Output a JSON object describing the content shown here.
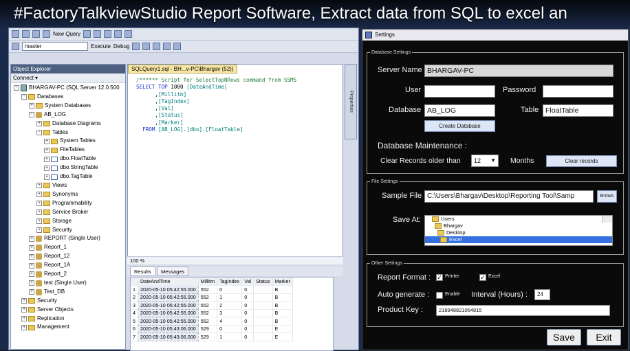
{
  "video_title": "#FactoryTalkviewStudio Report Software, Extract data from SQL to excel an",
  "ssms": {
    "new_query": "New Query",
    "db_combo": "master",
    "execute": "Execute",
    "debug": "Debug",
    "object_explorer": {
      "title": "Object Explorer",
      "connect": "Connect",
      "tree": [
        {
          "label": "BHARGAV-PC (SQL Server 12.0.500",
          "level": 0,
          "exp": "-",
          "icon": "server-icon"
        },
        {
          "label": "Databases",
          "level": 1,
          "exp": "-",
          "icon": "folder-icon"
        },
        {
          "label": "System Databases",
          "level": 2,
          "exp": "+",
          "icon": "folder-icon"
        },
        {
          "label": "AB_LOG",
          "level": 2,
          "exp": "-",
          "icon": "database-icon"
        },
        {
          "label": "Database Diagrams",
          "level": 3,
          "exp": "+",
          "icon": "folder-icon"
        },
        {
          "label": "Tables",
          "level": 3,
          "exp": "-",
          "icon": "folder-icon"
        },
        {
          "label": "System Tables",
          "level": 4,
          "exp": "+",
          "icon": "folder-icon"
        },
        {
          "label": "FileTables",
          "level": 4,
          "exp": "+",
          "icon": "folder-icon"
        },
        {
          "label": "dbo.FloatTable",
          "level": 4,
          "exp": "+",
          "icon": "table-icon"
        },
        {
          "label": "dbo.StringTable",
          "level": 4,
          "exp": "+",
          "icon": "table-icon"
        },
        {
          "label": "dbo.TagTable",
          "level": 4,
          "exp": "+",
          "icon": "table-icon"
        },
        {
          "label": "Views",
          "level": 3,
          "exp": "+",
          "icon": "folder-icon"
        },
        {
          "label": "Synonyms",
          "level": 3,
          "exp": "+",
          "icon": "folder-icon"
        },
        {
          "label": "Programmability",
          "level": 3,
          "exp": "+",
          "icon": "folder-icon"
        },
        {
          "label": "Service Broker",
          "level": 3,
          "exp": "+",
          "icon": "folder-icon"
        },
        {
          "label": "Storage",
          "level": 3,
          "exp": "+",
          "icon": "folder-icon"
        },
        {
          "label": "Security",
          "level": 3,
          "exp": "+",
          "icon": "folder-icon"
        },
        {
          "label": "REPORT (Single User)",
          "level": 2,
          "exp": "+",
          "icon": "database-icon"
        },
        {
          "label": "Report_1",
          "level": 2,
          "exp": "+",
          "icon": "database-icon"
        },
        {
          "label": "Report_12",
          "level": 2,
          "exp": "+",
          "icon": "database-icon"
        },
        {
          "label": "Report_1A",
          "level": 2,
          "exp": "+",
          "icon": "database-icon"
        },
        {
          "label": "Report_2",
          "level": 2,
          "exp": "+",
          "icon": "database-icon"
        },
        {
          "label": "test (Single User)",
          "level": 2,
          "exp": "+",
          "icon": "database-icon"
        },
        {
          "label": "Test_DB",
          "level": 2,
          "exp": "+",
          "icon": "database-icon"
        },
        {
          "label": "Security",
          "level": 1,
          "exp": "+",
          "icon": "folder-icon"
        },
        {
          "label": "Server Objects",
          "level": 1,
          "exp": "+",
          "icon": "folder-icon"
        },
        {
          "label": "Replication",
          "level": 1,
          "exp": "+",
          "icon": "folder-icon"
        },
        {
          "label": "Management",
          "level": 1,
          "exp": "+",
          "icon": "folder-icon"
        }
      ]
    },
    "editor": {
      "tab": "SQLQuery1.sql - BH...v-PC\\Bhargav (52))",
      "lines": [
        "/****** Script for SelectTopNRows command from SSMS",
        "SELECT TOP 1000 [DateAndTime]",
        "      ,[Millitm]",
        "      ,[TagIndex]",
        "      ,[Val]",
        "      ,[Status]",
        "      ,[Marker]",
        "  FROM [AB_LOG].[dbo].[FloatTable]"
      ]
    },
    "zoom": "100 %",
    "result_tabs": {
      "results": "Results",
      "messages": "Messages"
    },
    "results": {
      "columns": [
        "",
        "DateAndTime",
        "Millitm",
        "TagIndex",
        "Val",
        "Status",
        "Marker"
      ],
      "rows": [
        [
          "1",
          "2020-05-10 05:42:55.000",
          "552",
          "0",
          "0",
          "",
          "B"
        ],
        [
          "2",
          "2020-05-10 05:42:55.000",
          "552",
          "1",
          "0",
          "",
          "B"
        ],
        [
          "3",
          "2020-05-10 05:42:55.000",
          "552",
          "2",
          "0",
          "",
          "B"
        ],
        [
          "4",
          "2020-05-10 05:42:55.000",
          "552",
          "3",
          "0",
          "",
          "B"
        ],
        [
          "5",
          "2020-05-10 05:42:55.000",
          "552",
          "4",
          "0",
          "",
          "B"
        ],
        [
          "6",
          "2020-05-10 05:43:06.000",
          "529",
          "0",
          "0",
          "",
          "E"
        ],
        [
          "7",
          "2020-05-10 05:43:06.000",
          "529",
          "1",
          "0",
          "",
          "E"
        ]
      ]
    },
    "properties": "Properties"
  },
  "settings": {
    "title": "Settings",
    "db": {
      "legend": "Database Settings",
      "server_label": "Server Name",
      "server_value": "BHARGAV-PC",
      "user_label": "User",
      "user_value": "",
      "password_label": "Password",
      "password_value": "",
      "database_label": "Database",
      "database_value": "AB_LOG",
      "table_label": "Table",
      "table_value": "FloatTable",
      "create_btn": "Create Database",
      "maint_label": "Database Maintenance :",
      "clear_label": "Clear Records older than",
      "months_value": "12",
      "months_label": "Months",
      "clear_btn": "Clear records"
    },
    "file": {
      "legend": "File Settings",
      "sample_label": "Sample File",
      "sample_value": "C:\\Users\\Bhargav\\Desktop\\Reporting Tool\\Samp",
      "browse_btn": "Brows",
      "save_label": "Save At:",
      "folders": [
        "Users",
        "Bhargav",
        "Desktop",
        "Excel"
      ]
    },
    "other": {
      "legend": "Other Settings",
      "format_label": "Report Format :",
      "printer": "Printer",
      "excel": "Excel",
      "autogen_label": "Auto generate :",
      "enable": "Enable",
      "interval_label": "Interval (Hours) :",
      "interval_value": "24",
      "key_label": "Product Key :",
      "key_value": "218948821064815"
    },
    "save_btn": "Save",
    "exit_btn": "Exit"
  }
}
